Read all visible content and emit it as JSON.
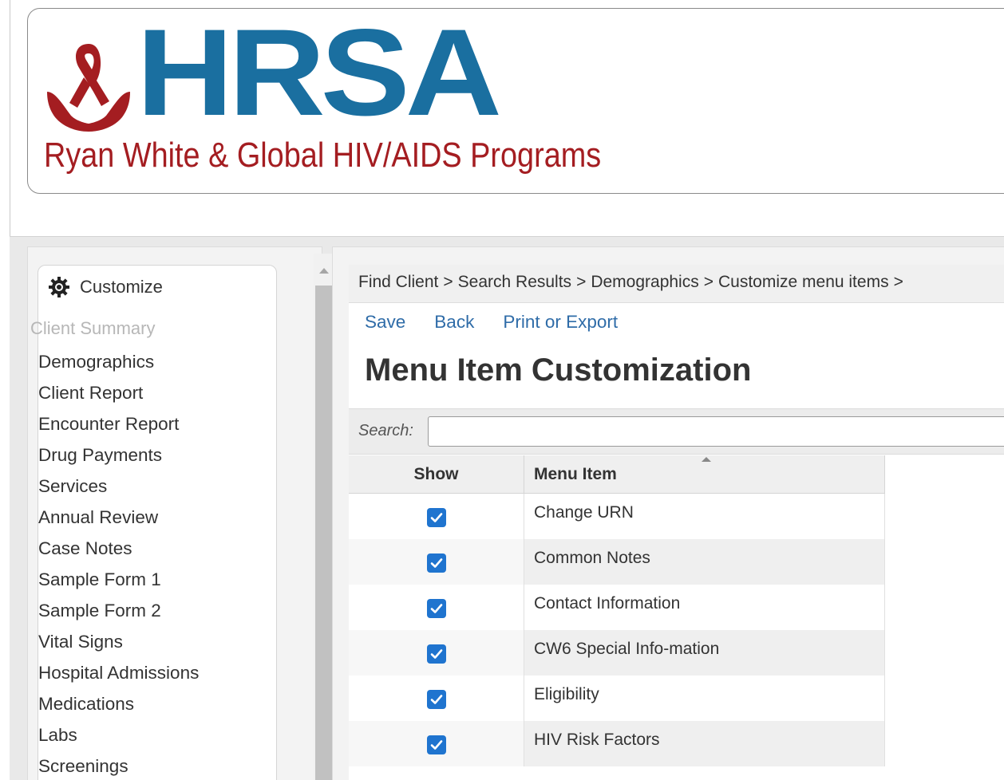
{
  "header": {
    "logo_acronym": "HRSA",
    "program_name": "Ryan White & Global HIV/AIDS Programs"
  },
  "sidebar": {
    "customize_label": "Customize",
    "disabled_item": "Client Summary",
    "items": [
      {
        "label": "Demographics"
      },
      {
        "label": "Client Report"
      },
      {
        "label": "Encounter Report"
      },
      {
        "label": "Drug Payments"
      },
      {
        "label": "Services"
      },
      {
        "label": "Annual Review"
      },
      {
        "label": "Case Notes"
      },
      {
        "label": "Sample Form 1"
      },
      {
        "label": "Sample Form 2"
      },
      {
        "label": "Vital Signs"
      },
      {
        "label": "Hospital Admissions"
      },
      {
        "label": "Medications"
      },
      {
        "label": "Labs"
      },
      {
        "label": "Screenings"
      }
    ]
  },
  "breadcrumb": {
    "items": [
      "Find Client",
      "Search Results",
      "Demographics",
      "Customize menu items"
    ],
    "separator": ">"
  },
  "toolbar": {
    "save_label": "Save",
    "back_label": "Back",
    "print_label": "Print or Export"
  },
  "main": {
    "title": "Menu Item Customization",
    "search_label": "Search:",
    "search_value": ""
  },
  "grid": {
    "columns": [
      "Show",
      "Menu Item"
    ],
    "rows": [
      {
        "show": true,
        "item": "Change URN"
      },
      {
        "show": true,
        "item": "Common Notes"
      },
      {
        "show": true,
        "item": "Contact Information"
      },
      {
        "show": true,
        "item": "CW6 Special Info-mation"
      },
      {
        "show": true,
        "item": "Eligibility"
      },
      {
        "show": true,
        "item": "HIV Risk Factors"
      }
    ]
  },
  "colors": {
    "brand_blue": "#1a6fa0",
    "brand_red": "#a41d21",
    "link_blue": "#2f6ca8",
    "checkbox_blue": "#1f74cf"
  },
  "icons": {
    "customize": "gear-icon",
    "logo_mark": "red-ribbon-hands-icon",
    "checked": "checkbox-checked-icon"
  }
}
